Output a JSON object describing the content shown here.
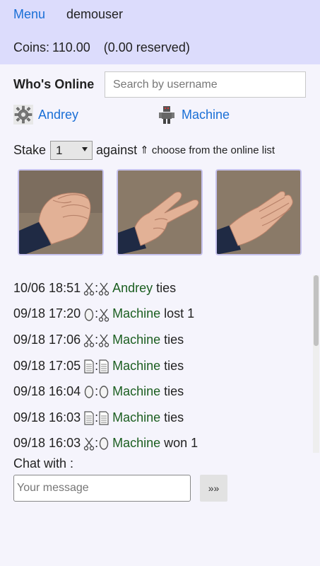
{
  "header": {
    "menu_label": "Menu",
    "username": "demouser",
    "coins_label": "Coins:",
    "coins_value": "110.00",
    "reserved": "(0.00 reserved)"
  },
  "online": {
    "title": "Who's Online",
    "search_placeholder": "Search by username",
    "users": [
      {
        "name": "Andrey",
        "icon": "cog-avatar-icon"
      },
      {
        "name": "Machine",
        "icon": "robot-avatar-icon"
      }
    ]
  },
  "stake": {
    "label": "Stake",
    "value": "1",
    "against": "against",
    "hint": "⇑ choose from the online list"
  },
  "moves": [
    {
      "name": "rock",
      "icon": "rock-hand-icon"
    },
    {
      "name": "scissors",
      "icon": "scissors-hand-icon"
    },
    {
      "name": "paper",
      "icon": "paper-hand-icon"
    }
  ],
  "history": [
    {
      "date": "10/06 18:51",
      "mine": "scissors",
      "theirs": "scissors",
      "opponent": "Andrey",
      "result": "ties"
    },
    {
      "date": "09/18 17:20",
      "mine": "rock",
      "theirs": "scissors",
      "opponent": "Machine",
      "result": "lost 1"
    },
    {
      "date": "09/18 17:06",
      "mine": "scissors",
      "theirs": "scissors",
      "opponent": "Machine",
      "result": "ties"
    },
    {
      "date": "09/18 17:05",
      "mine": "paper",
      "theirs": "paper",
      "opponent": "Machine",
      "result": "ties"
    },
    {
      "date": "09/18 16:04",
      "mine": "rock",
      "theirs": "rock",
      "opponent": "Machine",
      "result": "ties"
    },
    {
      "date": "09/18 16:03",
      "mine": "paper",
      "theirs": "paper",
      "opponent": "Machine",
      "result": "ties"
    },
    {
      "date": "09/18 16:03",
      "mine": "scissors",
      "theirs": "rock",
      "opponent": "Machine",
      "result": "won 1"
    }
  ],
  "chat": {
    "label": "Chat with :",
    "placeholder": "Your message",
    "send_label": "»»"
  },
  "colors": {
    "header_bg": "#dcdcfc",
    "link": "#1a6fd6",
    "opponent": "#1b5e20",
    "page_bg": "#f5f4fc"
  }
}
